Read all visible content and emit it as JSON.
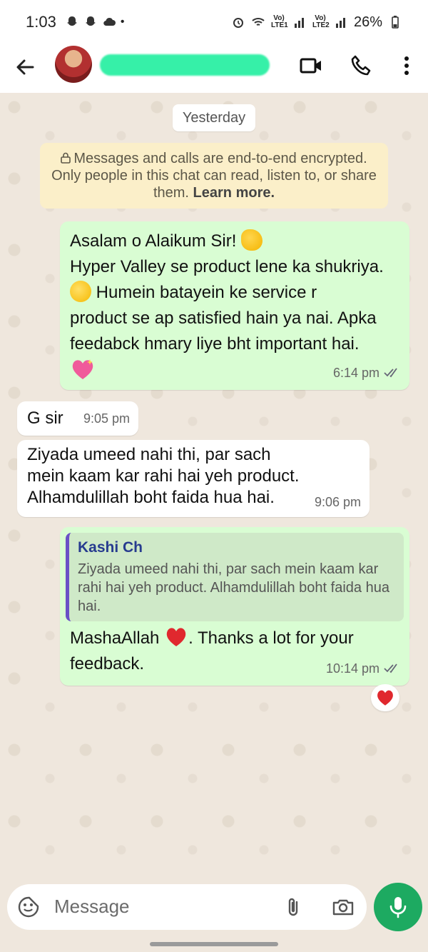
{
  "status_bar": {
    "time": "1:03",
    "battery": "26%",
    "lte1": "Vo) LTE1",
    "lte2": "Vo) LTE2"
  },
  "header": {
    "contact_name": "",
    "back_label": "",
    "avatar_label": ""
  },
  "chat": {
    "date_chip": "Yesterday",
    "encryption": {
      "text": "Messages and calls are end-to-end encrypted. Only people in this chat can read, listen to, or share them.",
      "learn_more": "Learn more."
    },
    "messages": [
      {
        "direction": "out",
        "line1": "Asalam o Alaikum Sir!",
        "line2": "Hyper Valley se product lene ka shukriya.",
        "line3": "Humein batayein ke service r",
        "line4": "product se ap satisfied hain ya nai. Apka",
        "line5": "feedabck hmary liye bht important hai.",
        "time": "6:14 pm"
      },
      {
        "direction": "in",
        "text": "G sir",
        "time": "9:05 pm"
      },
      {
        "direction": "in",
        "line1": "Ziyada umeed nahi thi, par sach",
        "line2": "mein kaam kar rahi hai yeh product.",
        "line3": "Alhamdulillah boht faida hua hai.",
        "time": "9:06 pm"
      },
      {
        "direction": "out",
        "quote_name": "Kashi Ch",
        "quote_text": "Ziyada umeed nahi thi, par sach mein kaam kar rahi hai yeh product. Alhamdulillah boht faida hua hai.",
        "reply_part1": "MashaAllah",
        "reply_part2": ". Thanks a lot for your feedback.",
        "time": "10:14 pm"
      }
    ],
    "reaction": "heart-emoji"
  },
  "composer": {
    "placeholder": "Message"
  },
  "colors": {
    "outgoing": "#d9fdd3",
    "incoming": "#ffffff",
    "accent": "#1daa61",
    "quote_bar": "#6a51c6"
  }
}
